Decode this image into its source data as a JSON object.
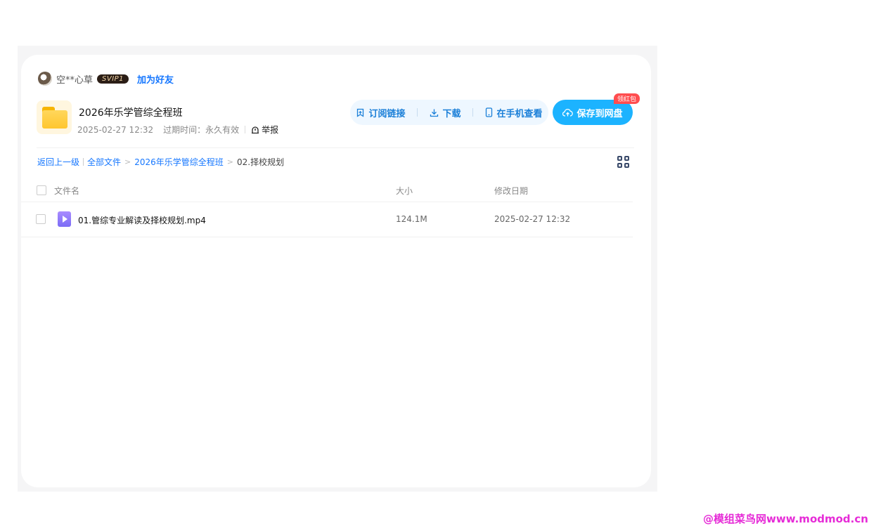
{
  "user": {
    "name": "空**心草",
    "badge": "SVIP1",
    "add_friend_label": "加为好友"
  },
  "share": {
    "folder_title": "2026年乐学管综全程班",
    "date": "2025-02-27 12:32",
    "expiry": "过期时间：永久有效",
    "report_label": "举报"
  },
  "actions": {
    "subscribe_label": "订阅链接",
    "download_label": "下载",
    "mobile_label": "在手机查看",
    "save_label": "保存到网盘",
    "redpack_badge": "领红包"
  },
  "breadcrumb": {
    "back_label": "返回上一级",
    "all_files_label": "全部文件",
    "folder_label": "2026年乐学管综全程班",
    "current_label": "02.择校规划"
  },
  "table": {
    "columns": [
      "文件名",
      "大小",
      "修改日期"
    ],
    "rows": [
      {
        "name": "01.管综专业解读及择校规划.mp4",
        "size": "124.1M",
        "date": "2025-02-27 12:32"
      }
    ]
  },
  "watermark": "@模组菜鸟网www.modmod.cn",
  "colors": {
    "accent": "#1677ff",
    "save_button": "#1cb3ff",
    "action_pill": "#eef7ff",
    "badge_red": "#ff4d4f"
  }
}
